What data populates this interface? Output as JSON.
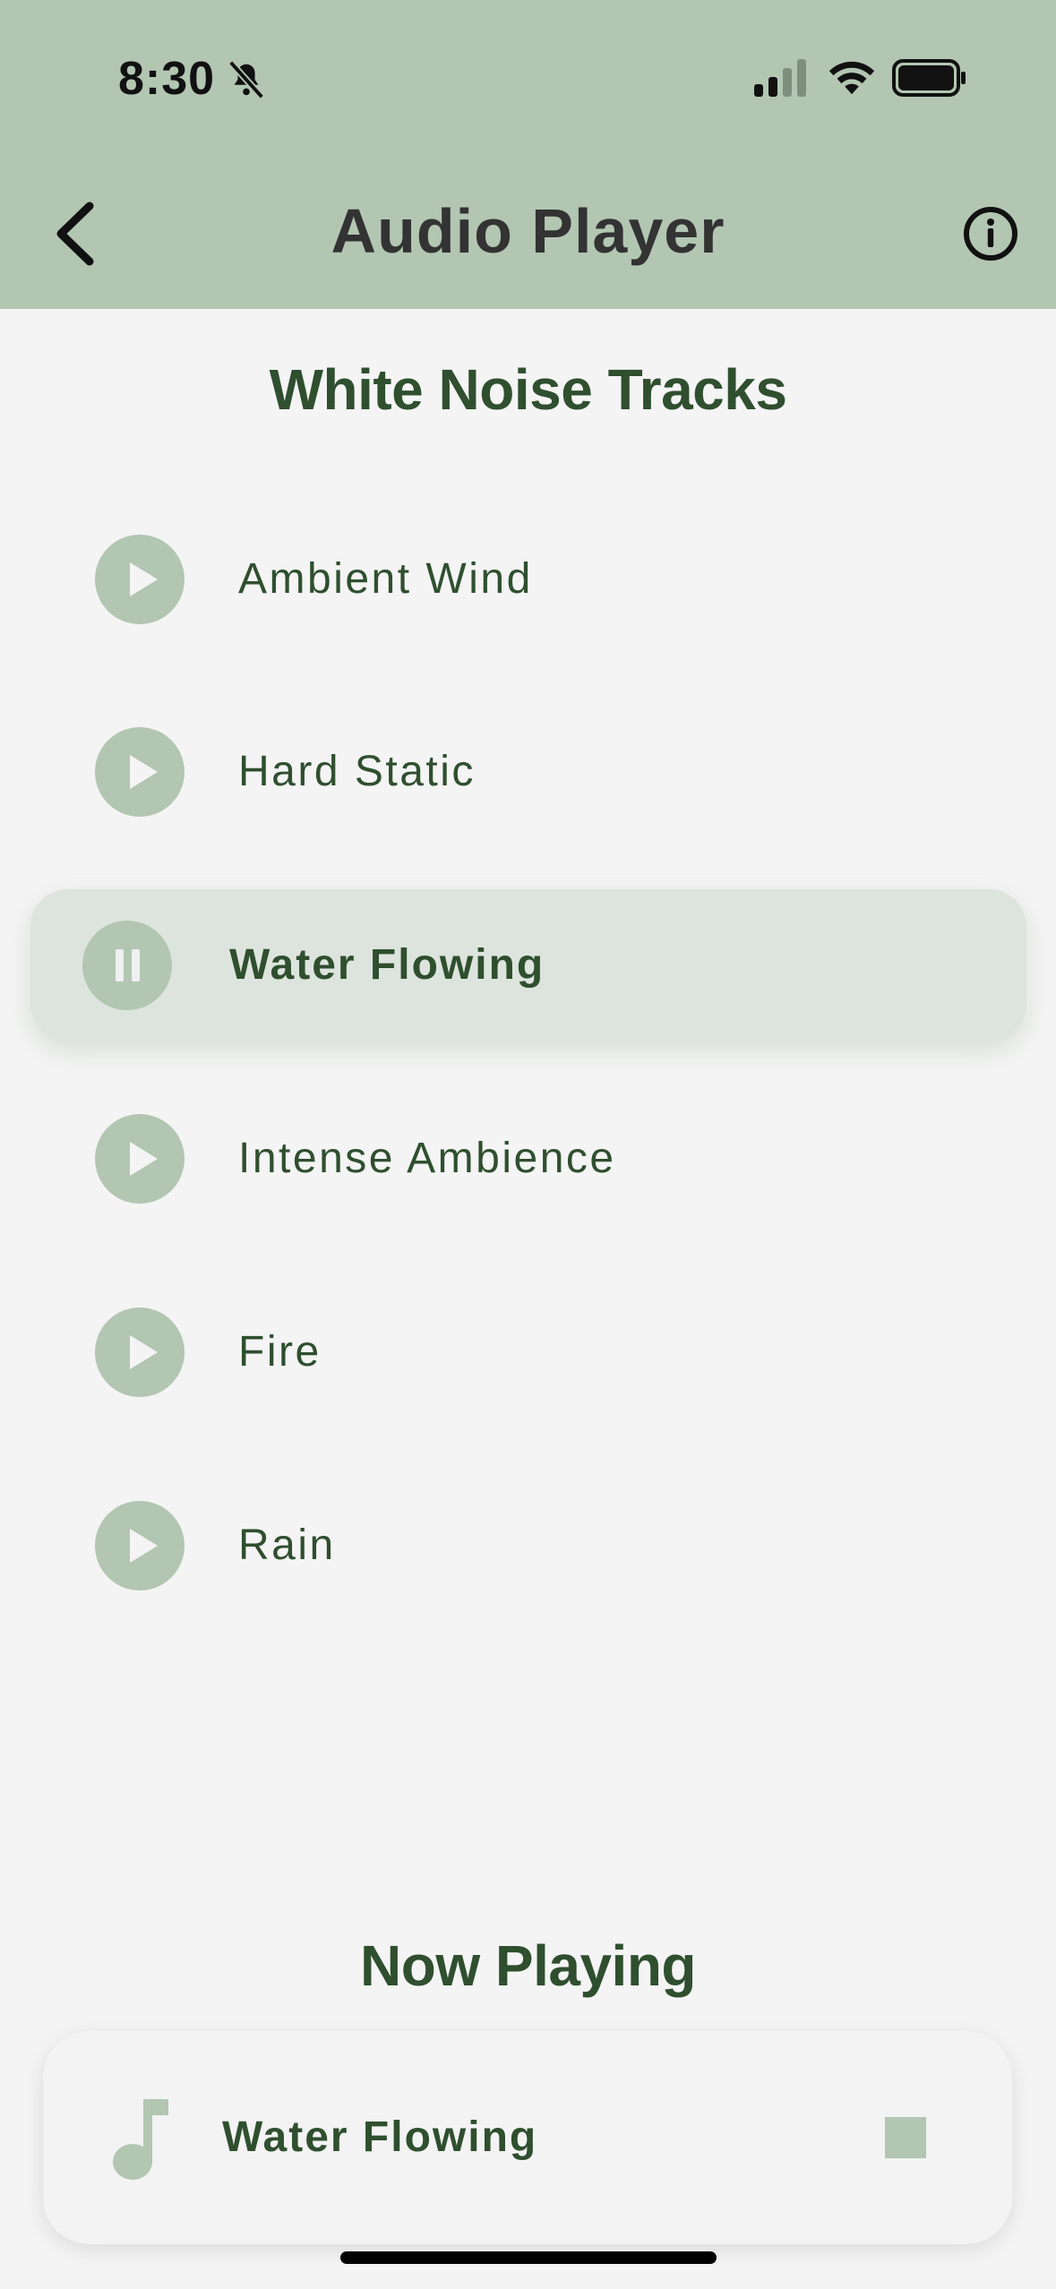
{
  "status_bar": {
    "time": "8:30",
    "icons": [
      "bell-slash-icon",
      "cellular-signal-icon",
      "wifi-icon",
      "battery-icon"
    ]
  },
  "header": {
    "title": "Audio Player",
    "back_icon": "chevron-left-icon",
    "info_icon": "info-circle-icon"
  },
  "tracks_section": {
    "title": "White Noise Tracks",
    "items": [
      {
        "label": "Ambient Wind",
        "state": "paused",
        "icon": "play-icon"
      },
      {
        "label": "Hard Static",
        "state": "paused",
        "icon": "play-icon"
      },
      {
        "label": "Water Flowing",
        "state": "playing",
        "icon": "pause-icon"
      },
      {
        "label": "Intense Ambience",
        "state": "paused",
        "icon": "play-icon"
      },
      {
        "label": "Fire",
        "state": "paused",
        "icon": "play-icon"
      },
      {
        "label": "Rain",
        "state": "paused",
        "icon": "play-icon"
      }
    ]
  },
  "now_playing": {
    "title": "Now Playing",
    "track": "Water Flowing",
    "icon": "music-note-icon",
    "stop_icon": "stop-icon"
  },
  "colors": {
    "header_bg": "#b2c6b2",
    "accent": "#b2c6b2",
    "text_green": "#2f4f2f",
    "active_row_bg": "#dde4dd",
    "page_bg": "#f4f4f4"
  }
}
